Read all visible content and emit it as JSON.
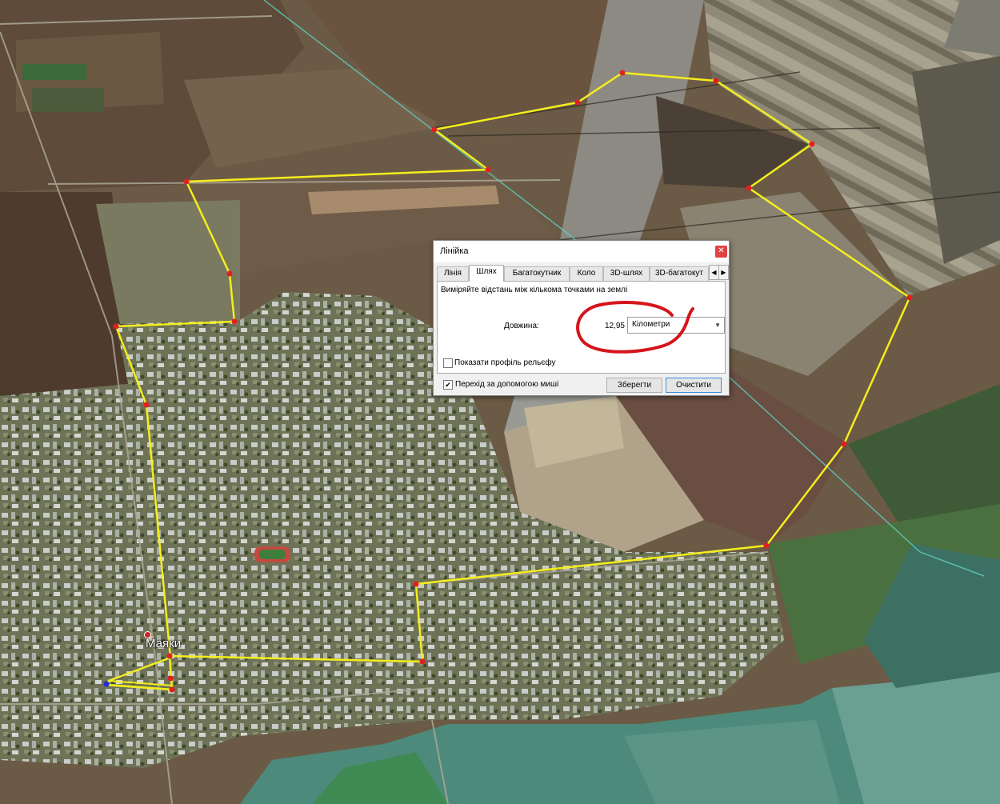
{
  "map": {
    "place_label": "Маяки",
    "path_color": "#f4ee1c",
    "point_color": "#e0201e",
    "annotation_color": "#d5151b"
  },
  "dialog": {
    "title": "Лінійка",
    "close_icon": "close-icon",
    "tabs": [
      {
        "label": "Лінія",
        "active": false
      },
      {
        "label": "Шлях",
        "active": true
      },
      {
        "label": "Багатокутник",
        "active": false
      },
      {
        "label": "Коло",
        "active": false
      },
      {
        "label": "3D-шлях",
        "active": false
      },
      {
        "label": "3D-багатокут",
        "active": false
      }
    ],
    "description": "Виміряйте відстань між кількома точками на землі",
    "length_label": "Довжина:",
    "length_value": "12,95",
    "unit_selected": "Кілометри",
    "show_elevation_label": "Показати профіль рельєфу",
    "show_elevation_checked": false,
    "mouse_nav_label": "Перехід за допомогою миші",
    "mouse_nav_checked": true,
    "save_label": "Зберегти",
    "clear_label": "Очистити"
  }
}
